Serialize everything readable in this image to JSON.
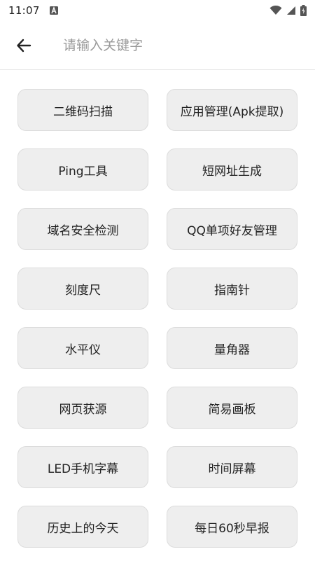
{
  "status_bar": {
    "time": "11:07",
    "notification_icon": "font-a-icon",
    "icons": [
      "wifi-icon",
      "signal-icon",
      "battery-charging-icon"
    ]
  },
  "app_bar": {
    "back_icon": "arrow-left-icon",
    "search_placeholder": "请输入关键字",
    "search_value": ""
  },
  "tools": [
    {
      "label": "二维码扫描"
    },
    {
      "label": "应用管理(Apk提取)"
    },
    {
      "label": "Ping工具"
    },
    {
      "label": "短网址生成"
    },
    {
      "label": "域名安全检测"
    },
    {
      "label": "QQ单项好友管理"
    },
    {
      "label": "刻度尺"
    },
    {
      "label": "指南针"
    },
    {
      "label": "水平仪"
    },
    {
      "label": "量角器"
    },
    {
      "label": "网页获源"
    },
    {
      "label": "简易画板"
    },
    {
      "label": "LED手机字幕"
    },
    {
      "label": "时间屏幕"
    },
    {
      "label": "历史上的今天"
    },
    {
      "label": "每日60秒早报"
    }
  ],
  "colors": {
    "button_bg": "#eeeeee",
    "button_border": "#dcdcdc",
    "placeholder": "#9a9a9a"
  }
}
